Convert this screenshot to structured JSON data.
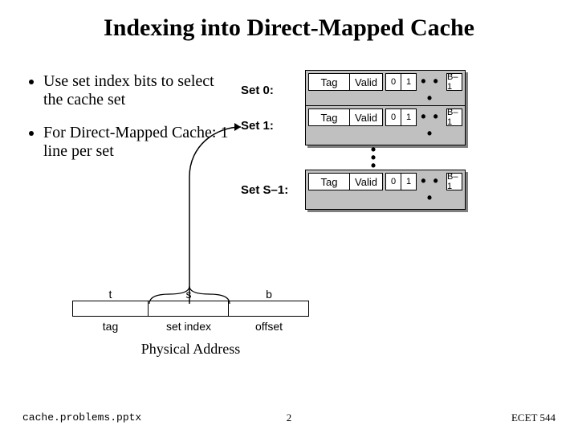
{
  "title": "Indexing into Direct-Mapped Cache",
  "bullets": [
    "Use set index bits to select the cache set",
    "For Direct-Mapped Cache: 1 line per set"
  ],
  "cache": {
    "sets": [
      "Set 0:",
      "Set 1:",
      "Set S–1:"
    ],
    "tag": "Tag",
    "valid": "Valid",
    "b0": "0",
    "b1": "1",
    "blast": "B–1",
    "dots": "• • •"
  },
  "pa": {
    "t": "t",
    "s": "s",
    "b": "b",
    "tag": "tag",
    "setindex": "set index",
    "offset": "offset",
    "caption": "Physical Address"
  },
  "footer": {
    "file": "cache.problems.pptx",
    "page": "2",
    "course": "ECET 544"
  }
}
